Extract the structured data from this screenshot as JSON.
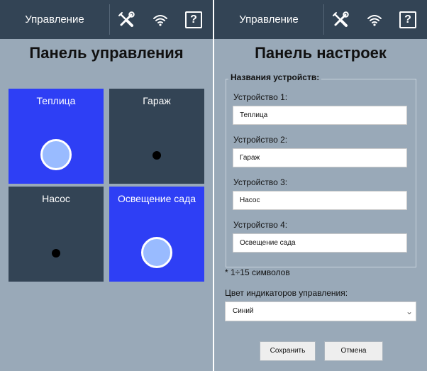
{
  "colors": {
    "topbar": "#334455",
    "screen_bg": "#99a9b8",
    "tile_on": "#2e3ff5",
    "tile_off": "#334455",
    "indicator_on": "#99bbff"
  },
  "left_screen": {
    "topbar": {
      "title": "Управление",
      "icons": [
        "tools-icon",
        "wifi-icon",
        "help-icon"
      ],
      "help_glyph": "?"
    },
    "heading": "Панель управления",
    "tiles": [
      {
        "label": "Теплица",
        "state": "on"
      },
      {
        "label": "Гараж",
        "state": "off"
      },
      {
        "label": "Насос",
        "state": "off"
      },
      {
        "label": "Освещение сада",
        "state": "on"
      }
    ]
  },
  "right_screen": {
    "topbar": {
      "title": "Управление",
      "icons": [
        "tools-icon",
        "wifi-icon",
        "help-icon"
      ],
      "help_glyph": "?"
    },
    "heading": "Панель настроек",
    "legend": "Названия устройств:",
    "devices": [
      {
        "label": "Устройство 1:",
        "value": "Теплица"
      },
      {
        "label": "Устройство 2:",
        "value": "Гараж"
      },
      {
        "label": "Устройство 3:",
        "value": "Насос"
      },
      {
        "label": "Устройство 4:",
        "value": "Освещение сада"
      }
    ],
    "note": "* 1÷15 символов",
    "color_label": "Цвет индикаторов управления:",
    "color_selected": "Синий",
    "save_label": "Сохранить",
    "cancel_label": "Отмена"
  }
}
